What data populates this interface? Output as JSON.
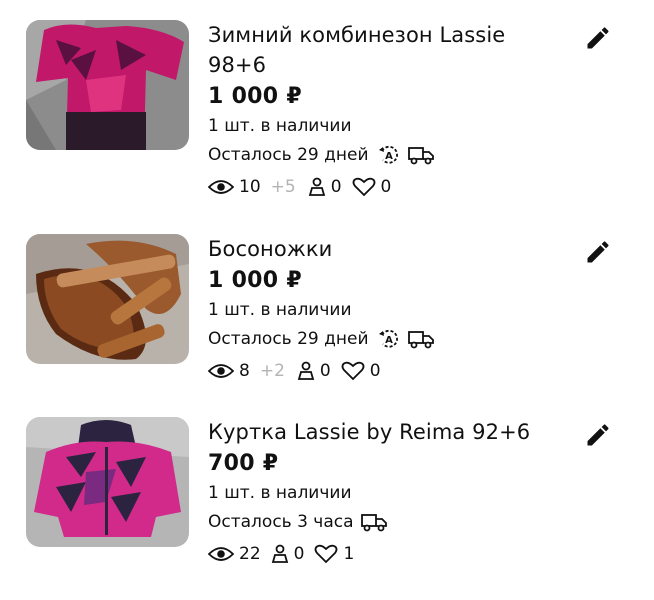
{
  "items": [
    {
      "title": "Зимний комбинезон Lassie 98+6",
      "price": "1 000 ₽",
      "stock": "1 шт. в наличии",
      "remaining": "Осталось 29 дней",
      "views": "10",
      "views_delta": "+5",
      "contacts": "0",
      "favorites": "0",
      "photo_colors": {
        "bg": "#9a9a9a",
        "main": "#c2186a",
        "accent": "#2a1a2a"
      }
    },
    {
      "title": "Босоножки",
      "price": "1 000 ₽",
      "stock": "1 шт. в наличии",
      "remaining": "Осталось 29 дней",
      "views": "8",
      "views_delta": "+2",
      "contacts": "0",
      "favorites": "0",
      "photo_colors": {
        "bg": "#b8b2aa",
        "main": "#8b4a22",
        "accent": "#c58b5a"
      }
    },
    {
      "title": "Куртка Lassie by Reima 92+6",
      "price": "700 ₽",
      "stock": "1 шт. в наличии",
      "remaining": "Осталось 3 часа",
      "views": "22",
      "contacts": "0",
      "favorites": "1",
      "photo_colors": {
        "bg": "#b5b5b5",
        "main": "#d12a8a",
        "accent": "#2b2340"
      }
    }
  ],
  "icons": {
    "edit": "pencil-icon",
    "autorenew": "auto-renew-icon",
    "delivery": "truck-icon",
    "views": "eye-icon",
    "contacts": "person-icon",
    "favorites": "heart-icon"
  },
  "colors": {
    "text": "#111111",
    "muted": "#b3b3b3"
  }
}
